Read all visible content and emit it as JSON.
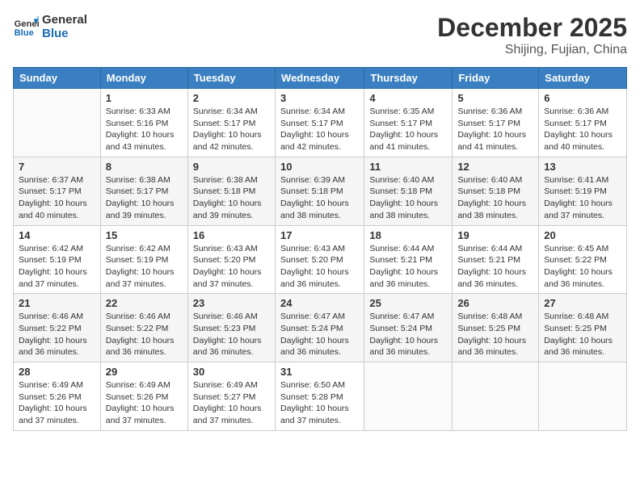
{
  "logo": {
    "general": "General",
    "blue": "Blue"
  },
  "title": "December 2025",
  "location": "Shijing, Fujian, China",
  "days_of_week": [
    "Sunday",
    "Monday",
    "Tuesday",
    "Wednesday",
    "Thursday",
    "Friday",
    "Saturday"
  ],
  "weeks": [
    [
      {
        "day": "",
        "info": ""
      },
      {
        "day": "1",
        "info": "Sunrise: 6:33 AM\nSunset: 5:16 PM\nDaylight: 10 hours\nand 43 minutes."
      },
      {
        "day": "2",
        "info": "Sunrise: 6:34 AM\nSunset: 5:17 PM\nDaylight: 10 hours\nand 42 minutes."
      },
      {
        "day": "3",
        "info": "Sunrise: 6:34 AM\nSunset: 5:17 PM\nDaylight: 10 hours\nand 42 minutes."
      },
      {
        "day": "4",
        "info": "Sunrise: 6:35 AM\nSunset: 5:17 PM\nDaylight: 10 hours\nand 41 minutes."
      },
      {
        "day": "5",
        "info": "Sunrise: 6:36 AM\nSunset: 5:17 PM\nDaylight: 10 hours\nand 41 minutes."
      },
      {
        "day": "6",
        "info": "Sunrise: 6:36 AM\nSunset: 5:17 PM\nDaylight: 10 hours\nand 40 minutes."
      }
    ],
    [
      {
        "day": "7",
        "info": "Sunrise: 6:37 AM\nSunset: 5:17 PM\nDaylight: 10 hours\nand 40 minutes."
      },
      {
        "day": "8",
        "info": "Sunrise: 6:38 AM\nSunset: 5:17 PM\nDaylight: 10 hours\nand 39 minutes."
      },
      {
        "day": "9",
        "info": "Sunrise: 6:38 AM\nSunset: 5:18 PM\nDaylight: 10 hours\nand 39 minutes."
      },
      {
        "day": "10",
        "info": "Sunrise: 6:39 AM\nSunset: 5:18 PM\nDaylight: 10 hours\nand 38 minutes."
      },
      {
        "day": "11",
        "info": "Sunrise: 6:40 AM\nSunset: 5:18 PM\nDaylight: 10 hours\nand 38 minutes."
      },
      {
        "day": "12",
        "info": "Sunrise: 6:40 AM\nSunset: 5:18 PM\nDaylight: 10 hours\nand 38 minutes."
      },
      {
        "day": "13",
        "info": "Sunrise: 6:41 AM\nSunset: 5:19 PM\nDaylight: 10 hours\nand 37 minutes."
      }
    ],
    [
      {
        "day": "14",
        "info": "Sunrise: 6:42 AM\nSunset: 5:19 PM\nDaylight: 10 hours\nand 37 minutes."
      },
      {
        "day": "15",
        "info": "Sunrise: 6:42 AM\nSunset: 5:19 PM\nDaylight: 10 hours\nand 37 minutes."
      },
      {
        "day": "16",
        "info": "Sunrise: 6:43 AM\nSunset: 5:20 PM\nDaylight: 10 hours\nand 37 minutes."
      },
      {
        "day": "17",
        "info": "Sunrise: 6:43 AM\nSunset: 5:20 PM\nDaylight: 10 hours\nand 36 minutes."
      },
      {
        "day": "18",
        "info": "Sunrise: 6:44 AM\nSunset: 5:21 PM\nDaylight: 10 hours\nand 36 minutes."
      },
      {
        "day": "19",
        "info": "Sunrise: 6:44 AM\nSunset: 5:21 PM\nDaylight: 10 hours\nand 36 minutes."
      },
      {
        "day": "20",
        "info": "Sunrise: 6:45 AM\nSunset: 5:22 PM\nDaylight: 10 hours\nand 36 minutes."
      }
    ],
    [
      {
        "day": "21",
        "info": "Sunrise: 6:46 AM\nSunset: 5:22 PM\nDaylight: 10 hours\nand 36 minutes."
      },
      {
        "day": "22",
        "info": "Sunrise: 6:46 AM\nSunset: 5:22 PM\nDaylight: 10 hours\nand 36 minutes."
      },
      {
        "day": "23",
        "info": "Sunrise: 6:46 AM\nSunset: 5:23 PM\nDaylight: 10 hours\nand 36 minutes."
      },
      {
        "day": "24",
        "info": "Sunrise: 6:47 AM\nSunset: 5:24 PM\nDaylight: 10 hours\nand 36 minutes."
      },
      {
        "day": "25",
        "info": "Sunrise: 6:47 AM\nSunset: 5:24 PM\nDaylight: 10 hours\nand 36 minutes."
      },
      {
        "day": "26",
        "info": "Sunrise: 6:48 AM\nSunset: 5:25 PM\nDaylight: 10 hours\nand 36 minutes."
      },
      {
        "day": "27",
        "info": "Sunrise: 6:48 AM\nSunset: 5:25 PM\nDaylight: 10 hours\nand 36 minutes."
      }
    ],
    [
      {
        "day": "28",
        "info": "Sunrise: 6:49 AM\nSunset: 5:26 PM\nDaylight: 10 hours\nand 37 minutes."
      },
      {
        "day": "29",
        "info": "Sunrise: 6:49 AM\nSunset: 5:26 PM\nDaylight: 10 hours\nand 37 minutes."
      },
      {
        "day": "30",
        "info": "Sunrise: 6:49 AM\nSunset: 5:27 PM\nDaylight: 10 hours\nand 37 minutes."
      },
      {
        "day": "31",
        "info": "Sunrise: 6:50 AM\nSunset: 5:28 PM\nDaylight: 10 hours\nand 37 minutes."
      },
      {
        "day": "",
        "info": ""
      },
      {
        "day": "",
        "info": ""
      },
      {
        "day": "",
        "info": ""
      }
    ]
  ]
}
